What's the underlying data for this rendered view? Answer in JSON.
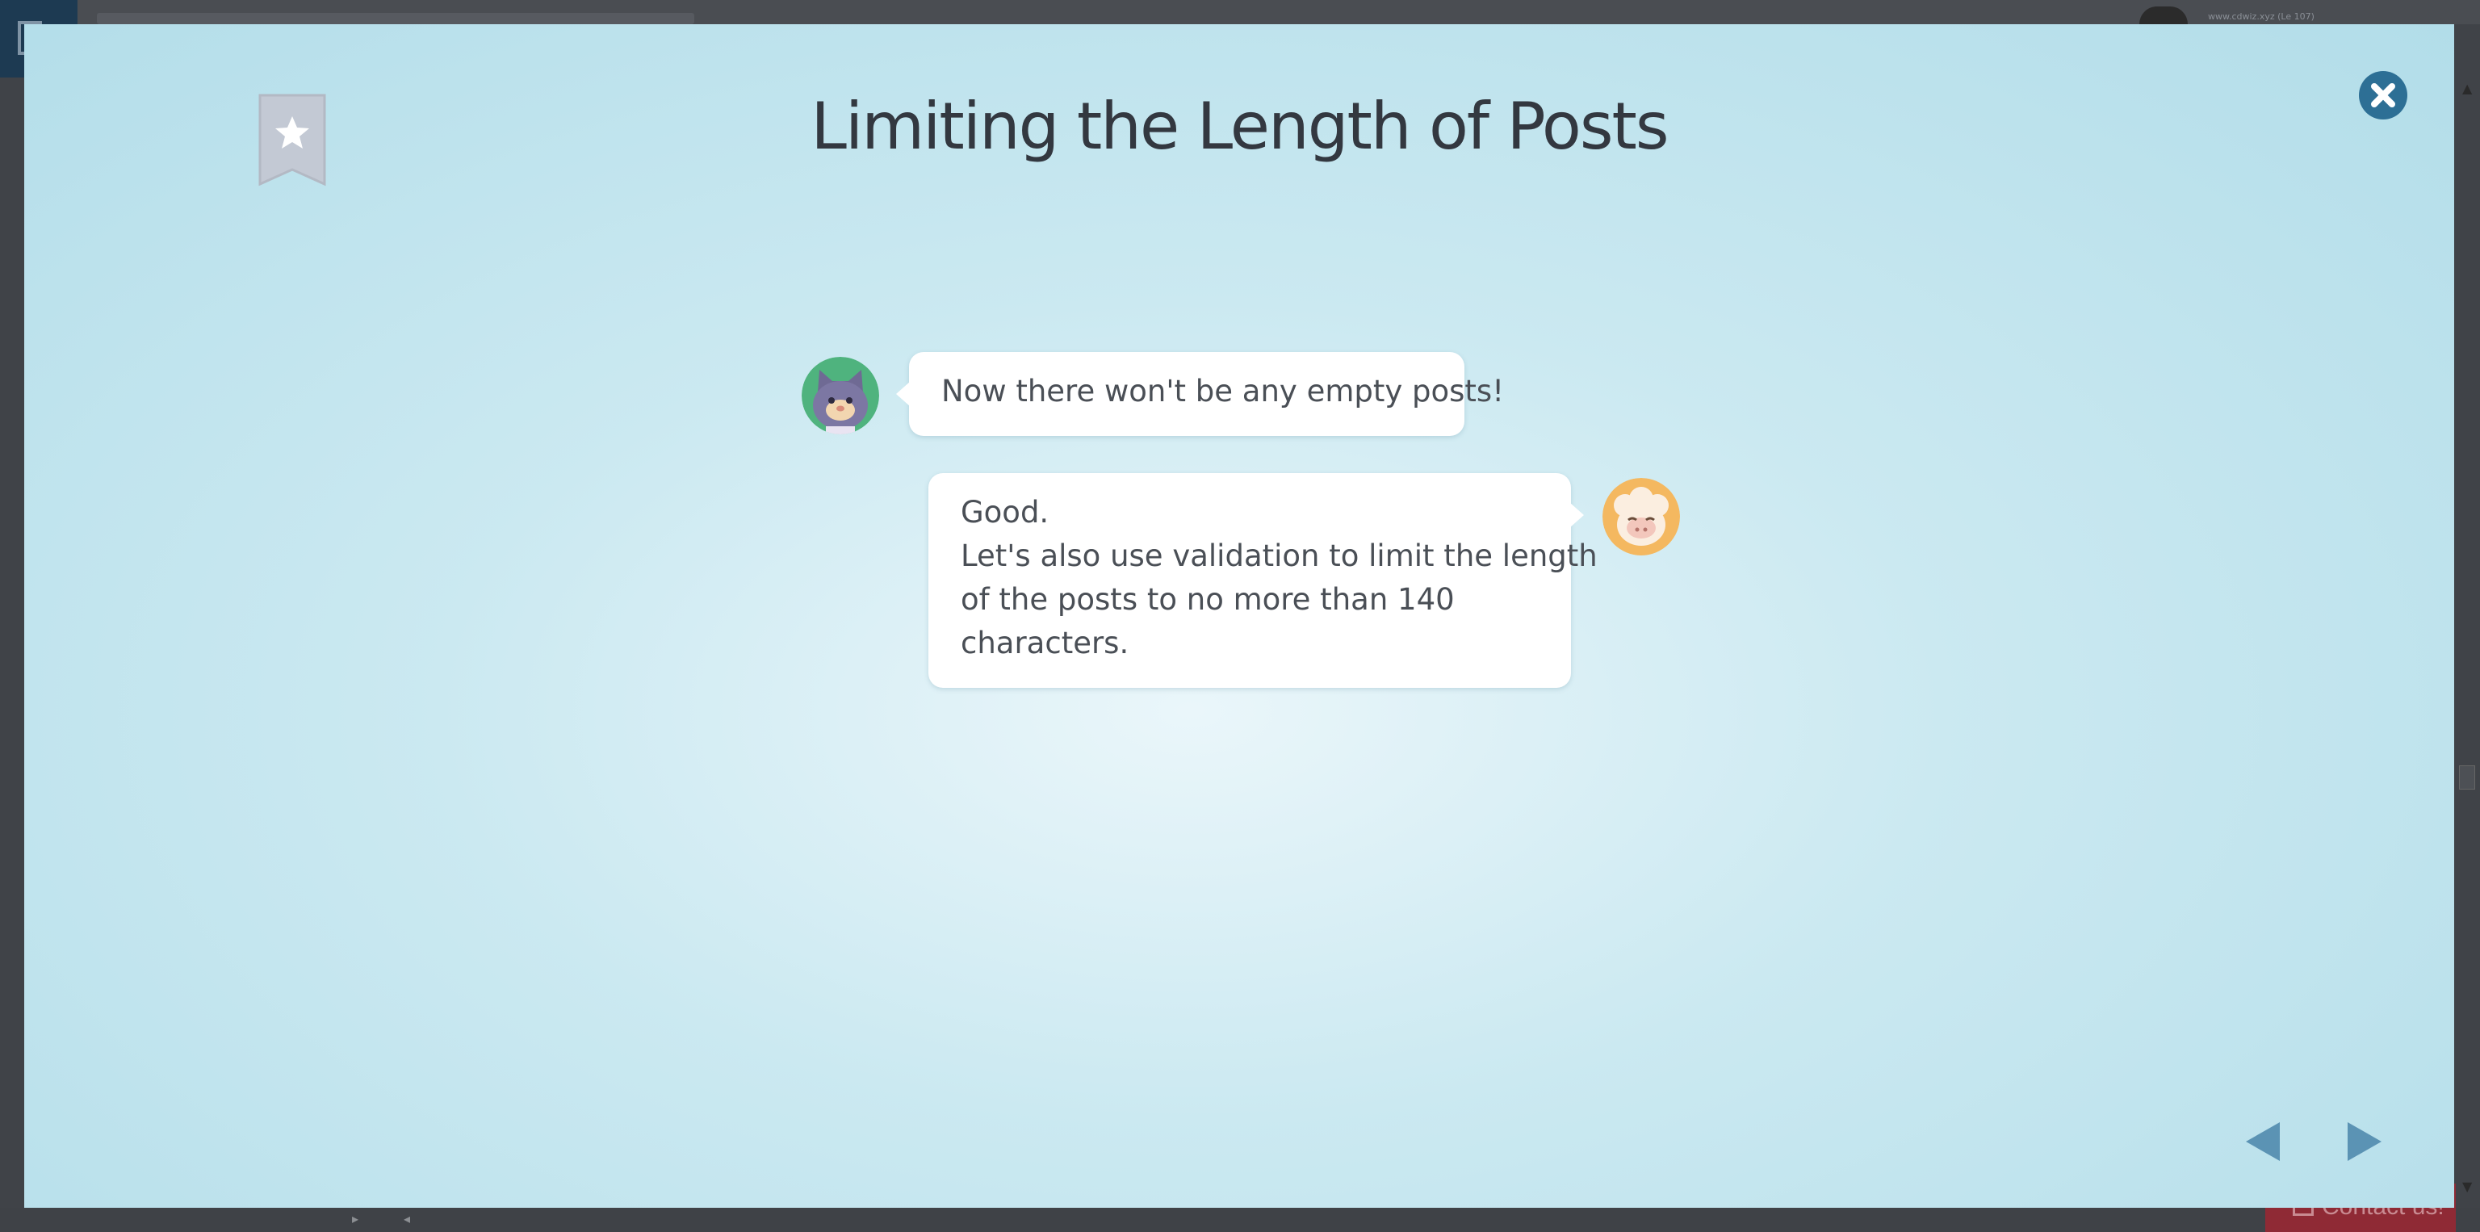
{
  "background": {
    "url_text": "www.cdwiz.xyz (Le 107)",
    "contact_label": "Contact us!"
  },
  "lesson": {
    "title": "Limiting the Length of Posts",
    "bookmark_icon": "star-bookmark-icon",
    "close_icon": "close-icon"
  },
  "dialogue": [
    {
      "speaker": "cat",
      "side": "left",
      "avatar_color": "#4fb37e",
      "lines": [
        "Now there won't be any empty posts!"
      ]
    },
    {
      "speaker": "sheep",
      "side": "right",
      "avatar_color": "#f4b860",
      "lines": [
        "Good.",
        "Let's also use validation to limit the length",
        "of the posts to no more than 140",
        "characters."
      ]
    }
  ],
  "navigation": {
    "prev_icon": "triangle-left-icon",
    "next_icon": "triangle-right-icon",
    "arrow_color": "#5b93b4"
  },
  "colors": {
    "modal_center": "#eaf6fa",
    "modal_edge": "#b2dde9",
    "close_button": "#2d6f95",
    "bookmark": "#c3c9d4"
  }
}
